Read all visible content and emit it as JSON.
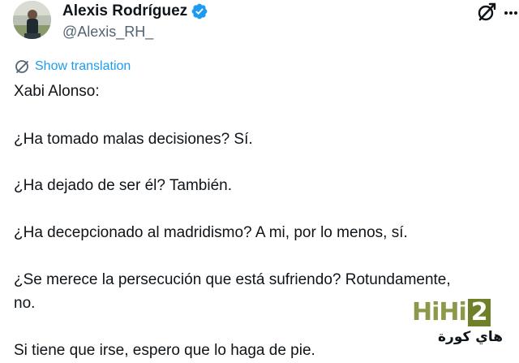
{
  "author": {
    "display_name": "Alexis Rodríguez",
    "handle": "@Alexis_RH_",
    "verified": true
  },
  "header_icons": {
    "grok": "grok-icon",
    "more": "more-icon"
  },
  "translation": {
    "label": "Show translation",
    "icon": "globe-translate-icon"
  },
  "tweet": {
    "lines": [
      "Xabi Alonso:",
      "¿Ha tomado malas decisiones? Sí.",
      "¿Ha dejado de ser él? También.",
      "¿Ha decepcionado al madridismo? A mi, por lo menos, sí.",
      "¿Se merece la persecución que está sufriendo? Rotundamente,",
      "no.",
      "Si tiene que irse, espero que lo haga de pie."
    ]
  },
  "watermark": {
    "brand_a": "HiHi",
    "brand_b": "2",
    "arabic": "هاي كورة"
  },
  "colors": {
    "text": "#0f1419",
    "muted": "#536471",
    "link": "#1d9bf0",
    "verified": "#1d9bf0",
    "watermark_green": "#6f7f2a"
  }
}
